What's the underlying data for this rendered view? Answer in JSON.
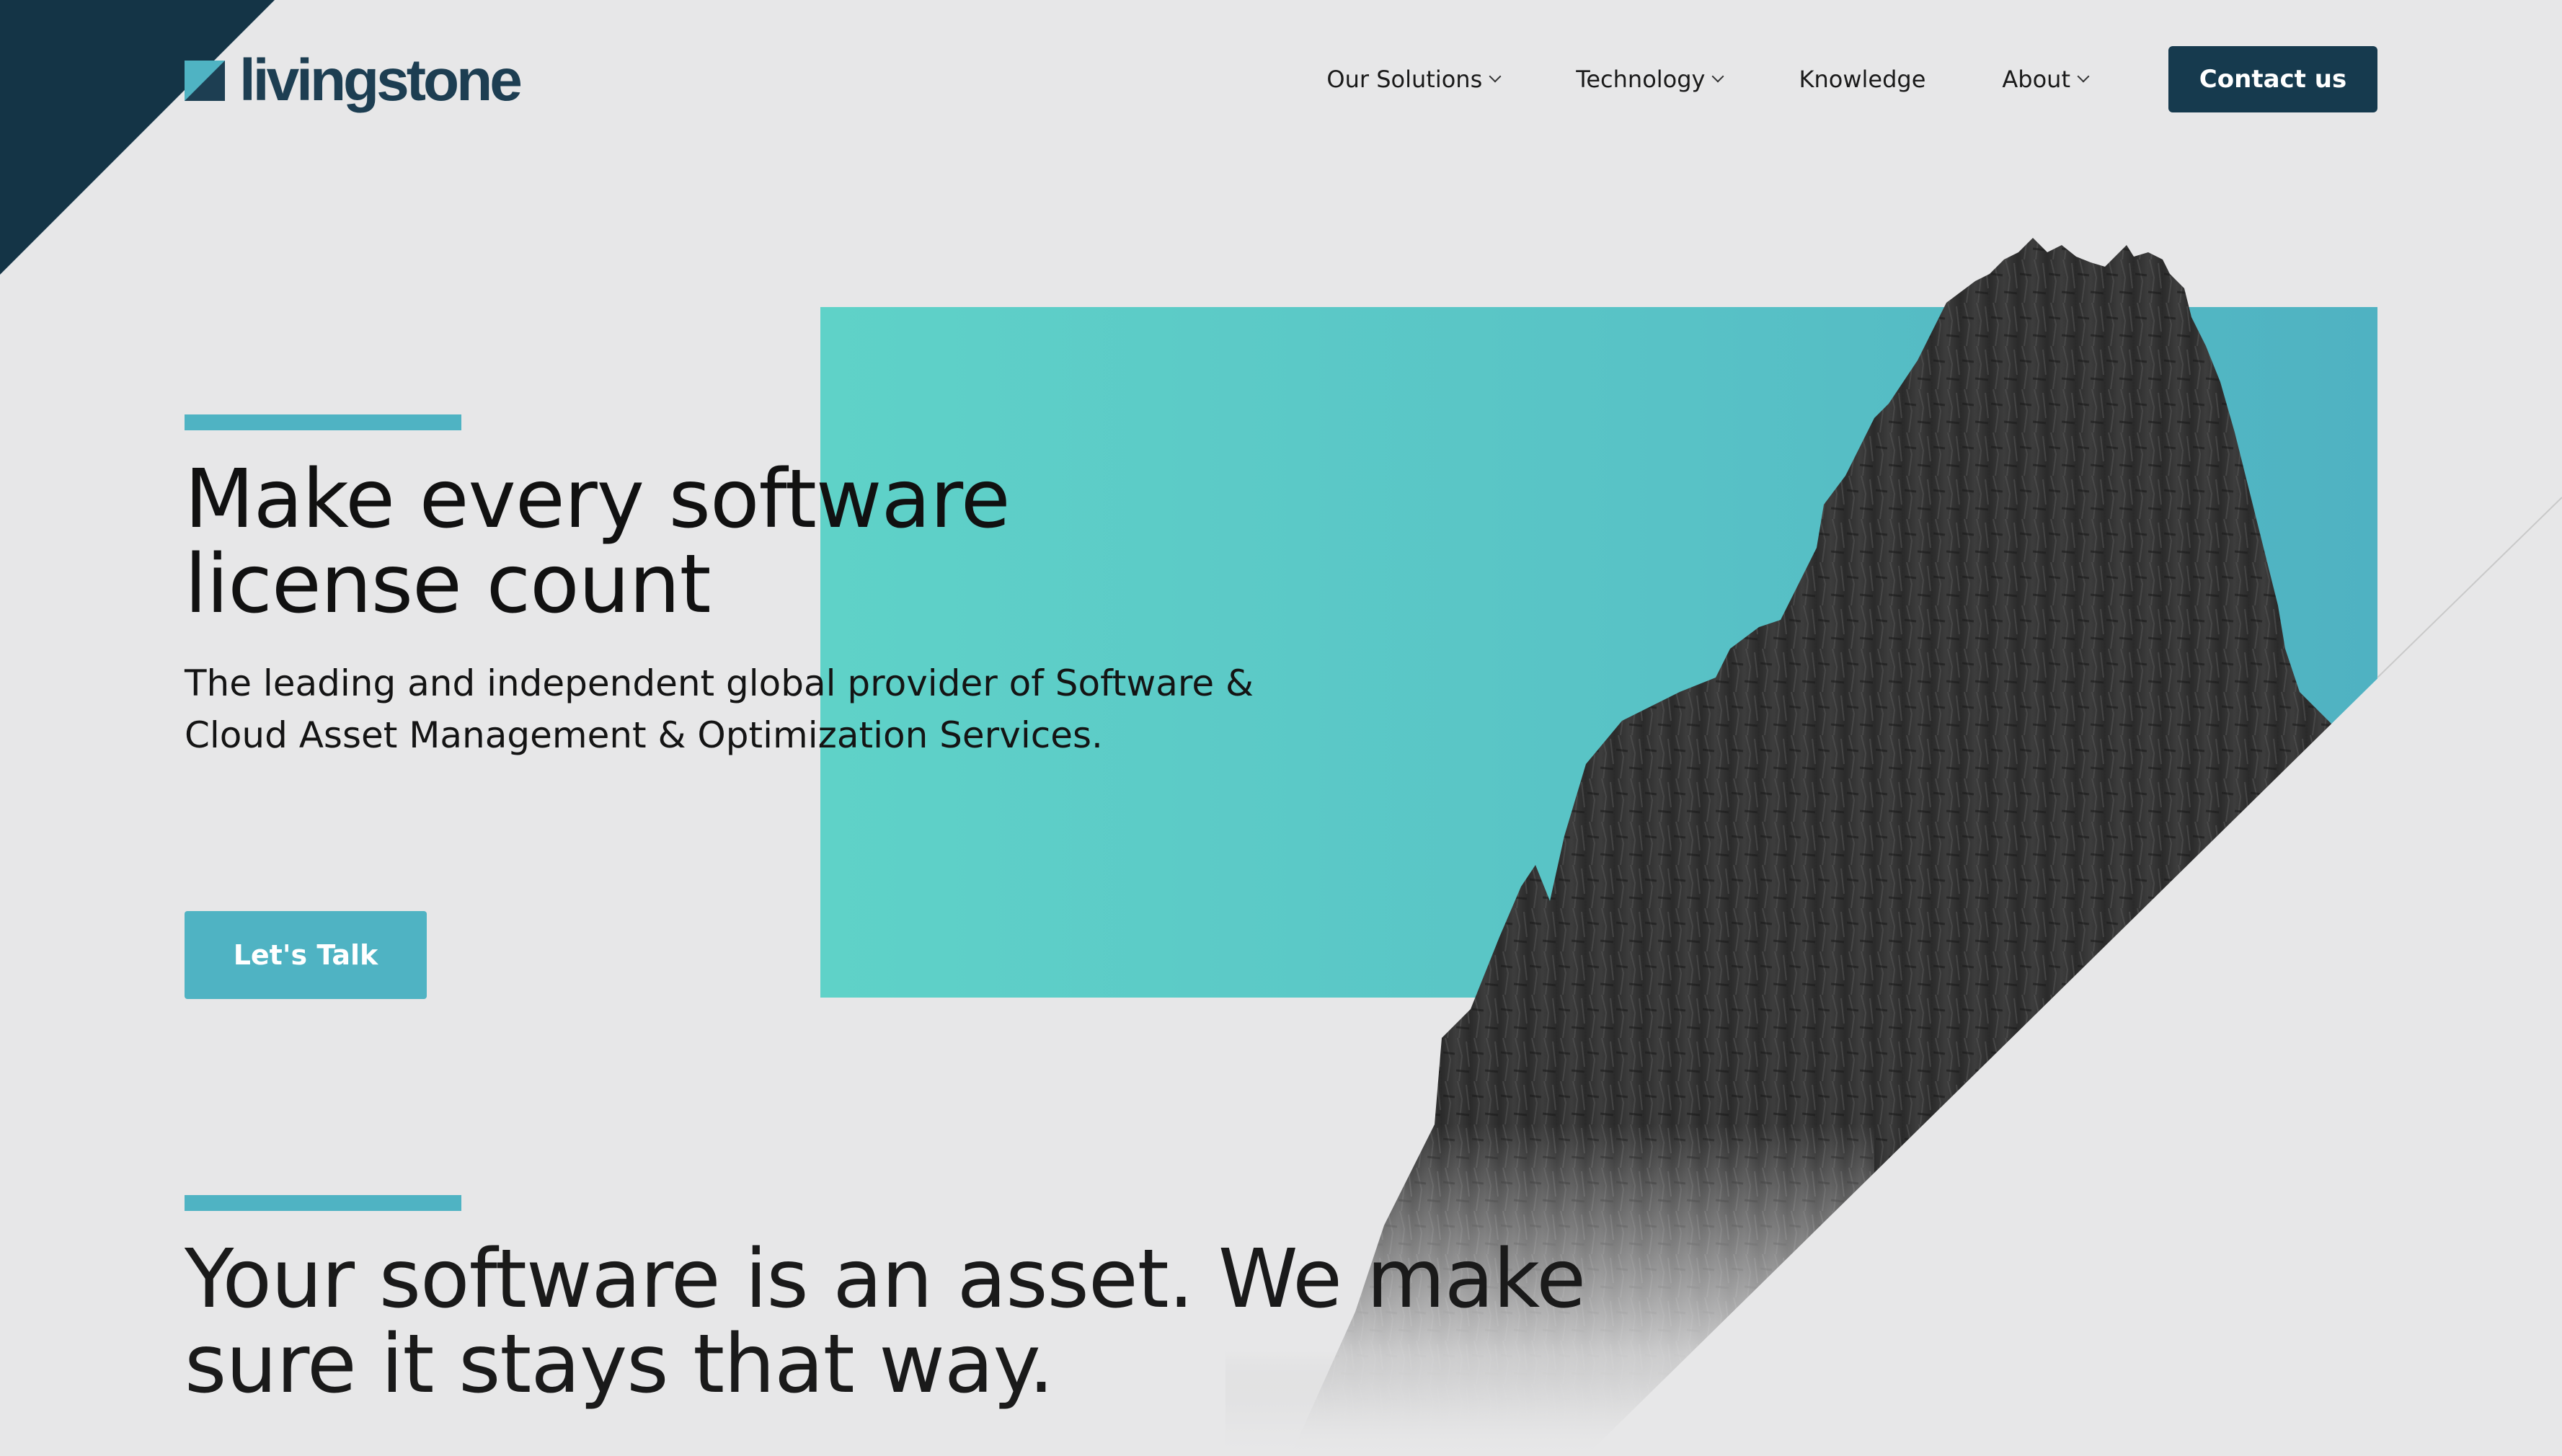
{
  "brand": {
    "name": "livingstone",
    "primary_color": "#163a4e",
    "accent_color": "#4fb3c3",
    "teal_color": "#5fd2c8",
    "background_color": "#e7e7e8"
  },
  "nav": {
    "items": [
      {
        "label": "Our Solutions",
        "has_dropdown": true
      },
      {
        "label": "Technology",
        "has_dropdown": true
      },
      {
        "label": "Knowledge",
        "has_dropdown": false
      },
      {
        "label": "About",
        "has_dropdown": true
      }
    ],
    "contact_label": "Contact us"
  },
  "hero": {
    "title": "Make every software license count",
    "subtitle": "The leading and independent global provider of Software & Cloud Asset Management & Optimization Services.",
    "cta_label": "Let's Talk",
    "image": "mountain-peak-grayscale"
  },
  "section": {
    "title": "Your software is an asset. We make sure it stays that way."
  }
}
